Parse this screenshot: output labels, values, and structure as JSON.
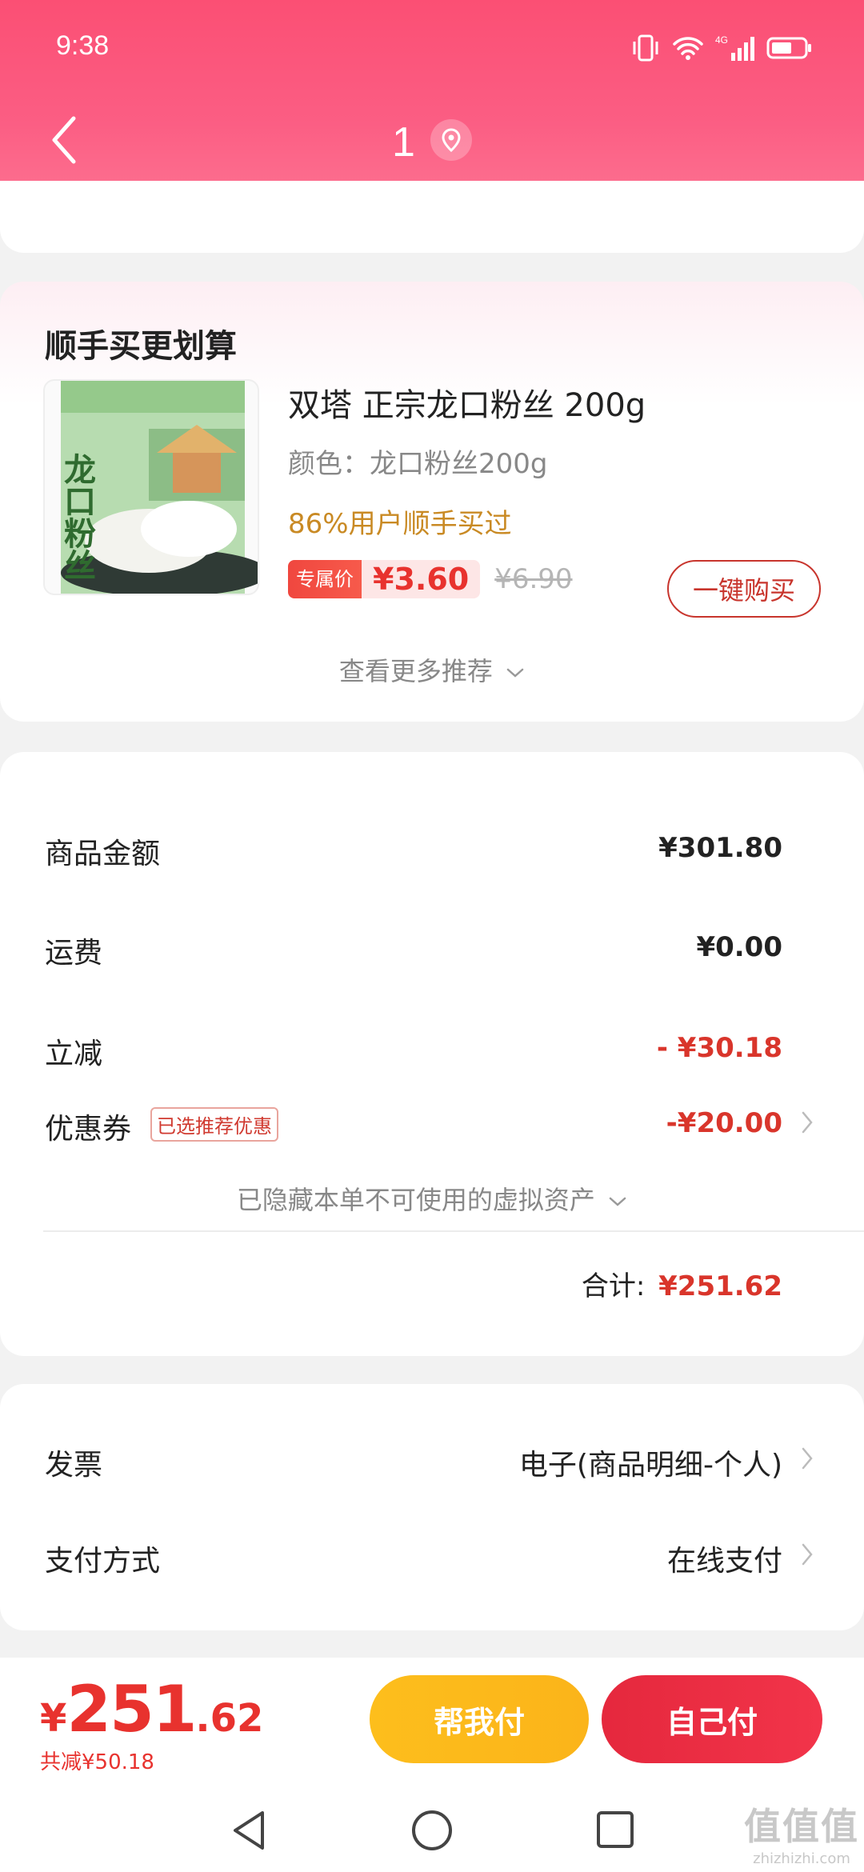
{
  "status_bar": {
    "time": "9:38",
    "network": "4G"
  },
  "nav": {
    "title": "1"
  },
  "recommend": {
    "title": "顺手买更划算",
    "product": {
      "name": "双塔 正宗龙口粉丝 200g",
      "spec": "颜色：龙口粉丝200g",
      "stat": "86%用户顺手买过",
      "price_tag": "专属价",
      "price": "¥3.60",
      "original_price": "¥6.90",
      "buy_label": "一键购买",
      "package_text": "龙口粉丝"
    },
    "more_label": "查看更多推荐"
  },
  "amounts": {
    "goods_label": "商品金额",
    "goods_value": "¥301.80",
    "shipping_label": "运费",
    "shipping_value": "¥0.00",
    "discount_label": "立减",
    "discount_value": "- ¥30.18",
    "coupon_label": "优惠券",
    "coupon_badge": "已选推荐优惠",
    "coupon_value": "-¥20.00",
    "hidden_assets": "已隐藏本单不可使用的虚拟资产",
    "total_label": "合计:",
    "total_value": "¥251.62"
  },
  "invoice": {
    "invoice_label": "发票",
    "invoice_value": "电子(商品明细-个人)",
    "payment_label": "支付方式",
    "payment_value": "在线支付"
  },
  "bottom": {
    "currency": "¥",
    "total_int": "251",
    "total_dec": ".62",
    "saved": "共减¥50.18",
    "help_pay": "帮我付",
    "self_pay": "自己付"
  },
  "watermark": {
    "logo": "值值值",
    "text": "zhizhizhi.com"
  },
  "colors": {
    "brand_red": "#e8322e",
    "header_pink": "#fb4f74",
    "help_pay_yellow": "#fdbe1c"
  }
}
